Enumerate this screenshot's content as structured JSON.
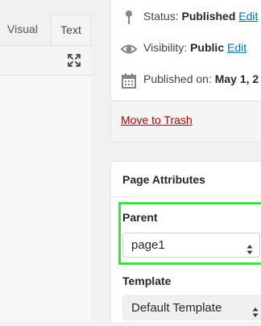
{
  "editor": {
    "tabs": [
      {
        "label": "Visual"
      },
      {
        "label": "Text"
      }
    ],
    "fullscreen_icon": "expand-arrows-icon"
  },
  "publish": {
    "status": {
      "label": "Status:",
      "value": "Published",
      "link": "Edit",
      "icon": "pin-icon"
    },
    "visibility": {
      "label": "Visibility:",
      "value": "Public",
      "link": "Edit",
      "icon": "eye-icon"
    },
    "published_on": {
      "label": "Published on:",
      "value": "May 1, 2",
      "icon": "calendar-icon"
    },
    "trash_label": "Move to Trash"
  },
  "page_attributes": {
    "title": "Page Attributes",
    "parent": {
      "label": "Parent",
      "selected": "page1"
    },
    "template": {
      "label": "Template",
      "selected": "Default Template"
    }
  },
  "colors": {
    "link": "#0073aa",
    "trash": "#aa0000",
    "highlight": "#3ee03e"
  }
}
